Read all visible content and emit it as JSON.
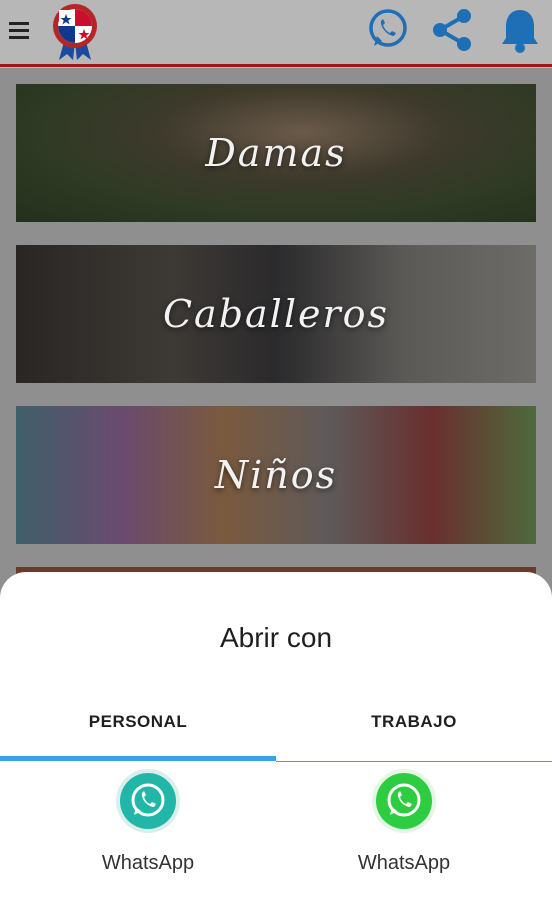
{
  "header": {
    "menu_icon": "menu-icon",
    "logo_icon": "panama-flag-ribbon-icon",
    "actions": [
      {
        "icon": "whatsapp-icon"
      },
      {
        "icon": "share-icon"
      },
      {
        "icon": "bell-icon"
      }
    ],
    "accent_color": "#9a1b1b",
    "action_color": "#1e6fb5"
  },
  "categories": [
    {
      "label": "Damas"
    },
    {
      "label": "Caballeros"
    },
    {
      "label": "Niños"
    }
  ],
  "sheet": {
    "title": "Abrir con",
    "tabs": [
      {
        "label": "PERSONAL",
        "selected": true
      },
      {
        "label": "TRABAJO",
        "selected": false
      }
    ],
    "apps": [
      {
        "label": "WhatsApp",
        "icon": "whatsapp-business-icon",
        "color": "#22b6a9"
      },
      {
        "label": "WhatsApp",
        "icon": "whatsapp-icon",
        "color": "#2ecc40"
      }
    ],
    "indicator_color": "#3aa0e8"
  }
}
